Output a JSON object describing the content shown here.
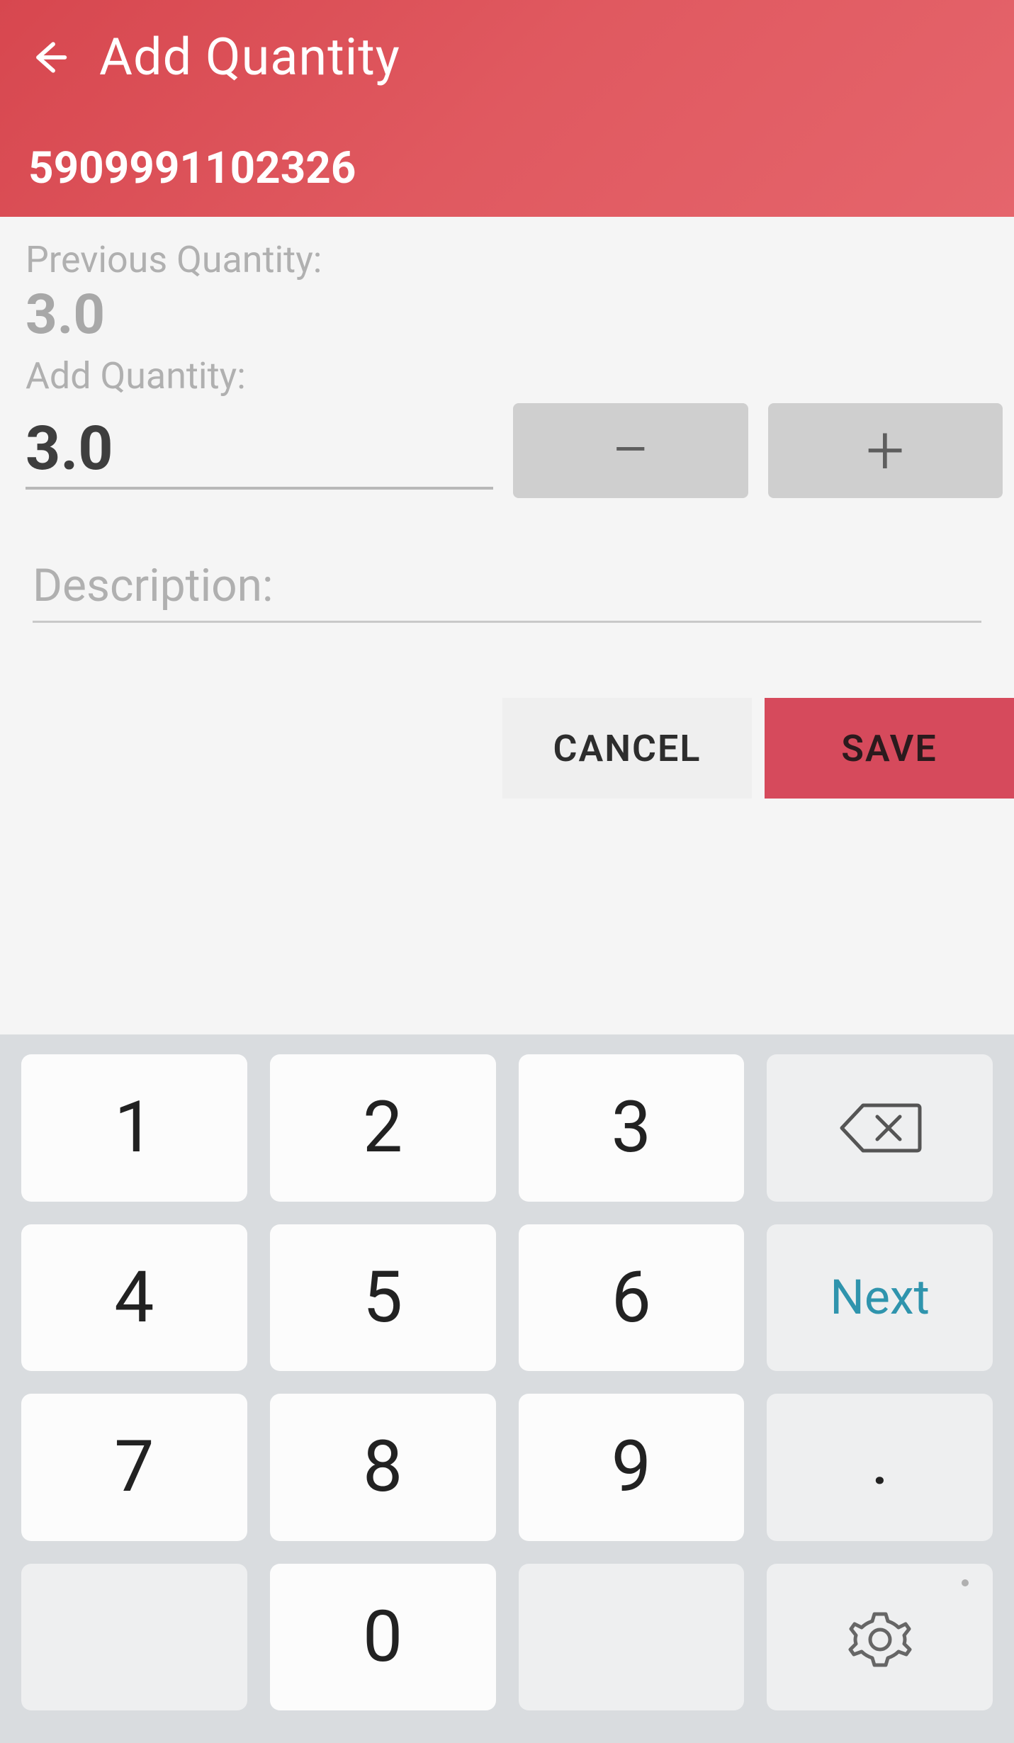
{
  "header": {
    "title": "Add Quantity",
    "barcode": "5909991102326"
  },
  "form": {
    "previous_label": "Previous Quantity:",
    "previous_value": "3.0",
    "add_label": "Add Quantity:",
    "add_value": "3.0",
    "description_placeholder": "Description:"
  },
  "actions": {
    "cancel": "CANCEL",
    "save": "SAVE"
  },
  "keypad": {
    "1": "1",
    "2": "2",
    "3": "3",
    "4": "4",
    "5": "5",
    "6": "6",
    "7": "7",
    "8": "8",
    "9": "9",
    "0": "0",
    "dot": ".",
    "next": "Next"
  }
}
